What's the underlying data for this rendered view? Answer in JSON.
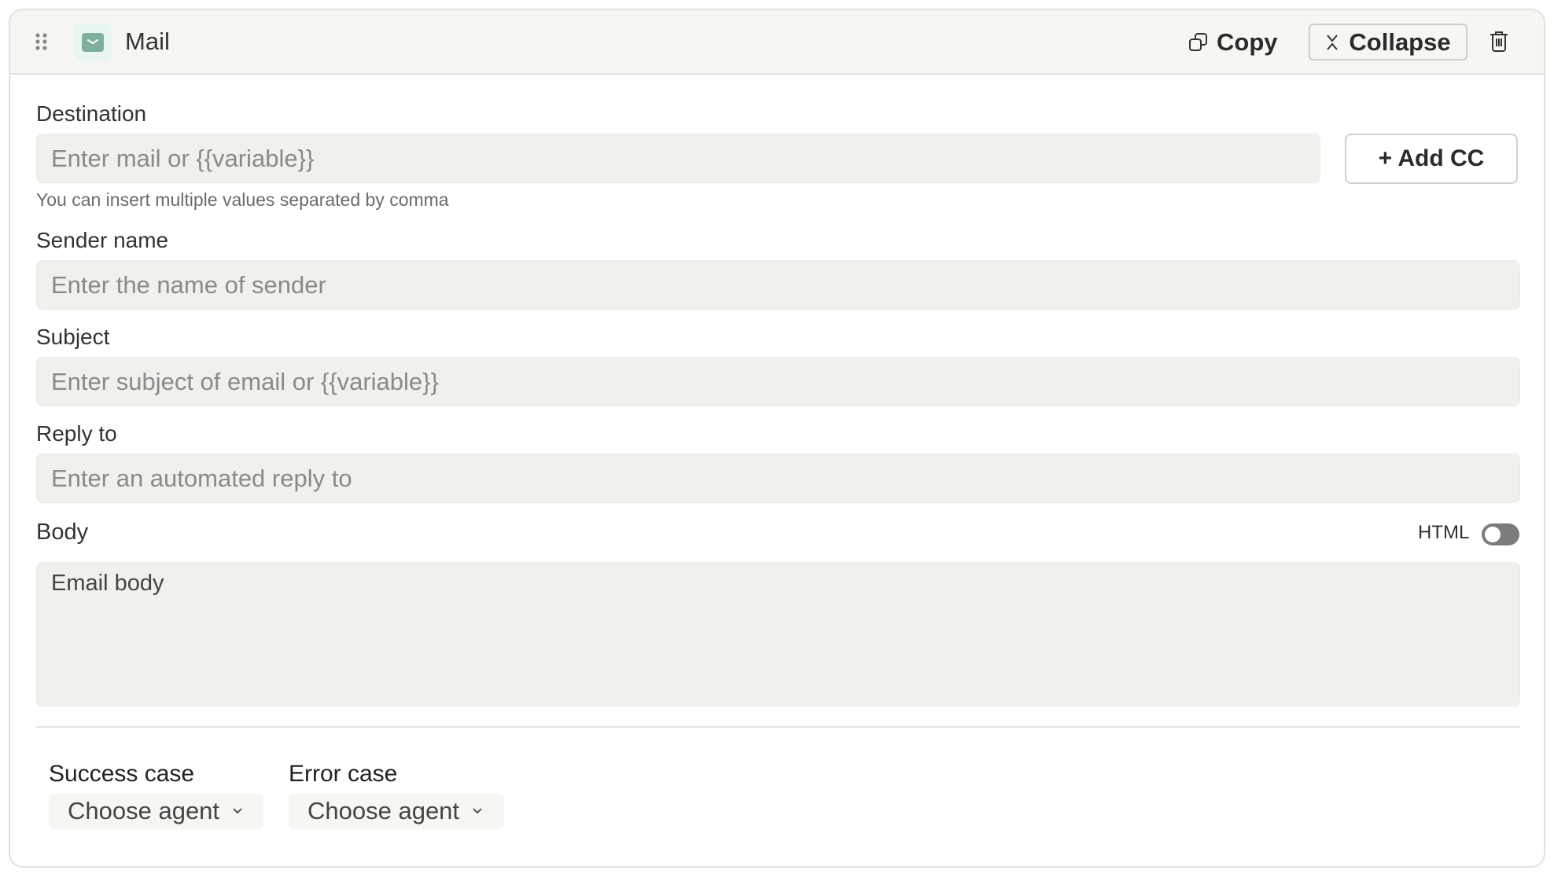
{
  "header": {
    "title": "Mail",
    "copy_label": "Copy",
    "collapse_label": "Collapse",
    "icon_color": "#7fae9b"
  },
  "form": {
    "destination": {
      "label": "Destination",
      "placeholder": "Enter mail or {{variable}}",
      "helper": "You can insert multiple values separated by comma",
      "add_cc_label": "+ Add CC"
    },
    "sender": {
      "label": "Sender name",
      "placeholder": "Enter the name of sender"
    },
    "subject": {
      "label": "Subject",
      "placeholder": "Enter subject of email or {{variable}}"
    },
    "reply_to": {
      "label": "Reply to",
      "placeholder": "Enter an automated reply to"
    },
    "body": {
      "label": "Body",
      "placeholder": "Email body",
      "html_toggle_label": "HTML",
      "html_enabled": false
    }
  },
  "footer": {
    "success": {
      "label": "Success case",
      "value": "Choose agent"
    },
    "error": {
      "label": "Error case",
      "value": "Choose agent"
    }
  }
}
